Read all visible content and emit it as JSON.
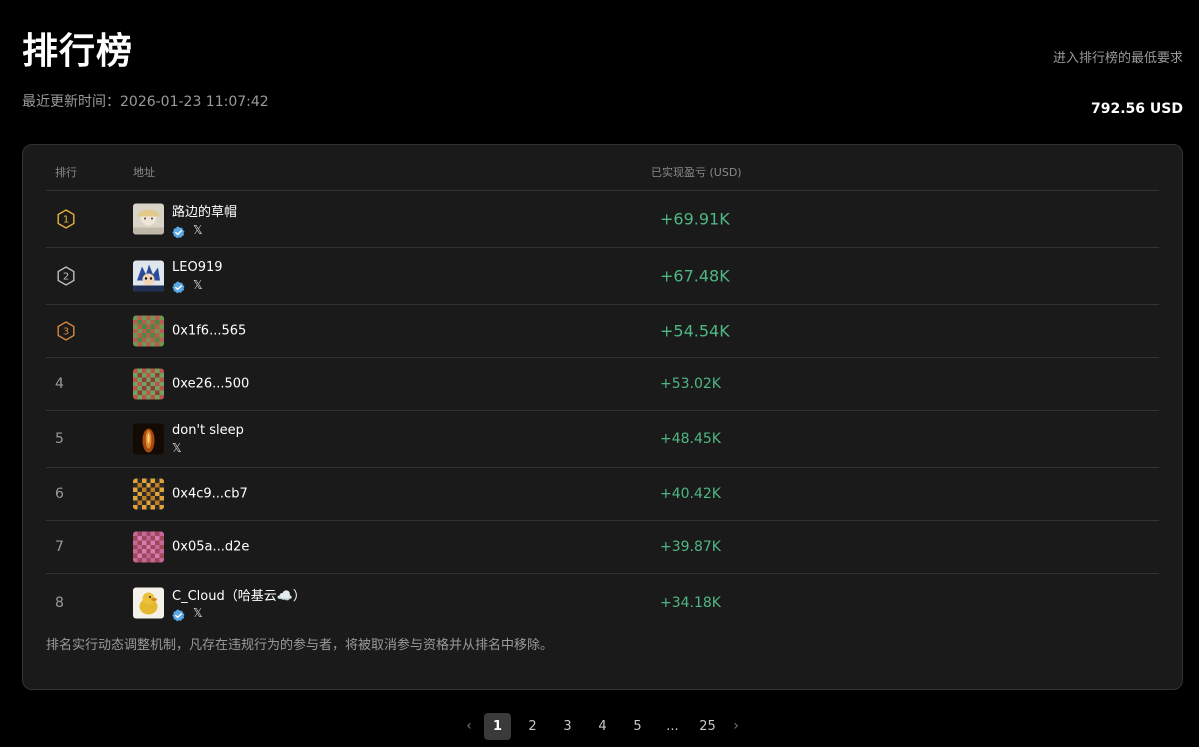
{
  "header": {
    "title": "排行榜",
    "updated": "最近更新时间：2026-01-23 11:07:42",
    "min_label": "进入排行榜的最低要求",
    "min_value": "792.56 USD"
  },
  "table": {
    "col_rank": "排行",
    "col_address": "地址",
    "col_pnl": "已实现盈亏 (USD)"
  },
  "rows": [
    {
      "rank": "1",
      "name": "路边的草帽",
      "verified": true,
      "x": true,
      "pnl": "+69.91K",
      "avatar": "photo-1",
      "medal": "gold"
    },
    {
      "rank": "2",
      "name": "LEO919",
      "verified": true,
      "x": true,
      "pnl": "+67.48K",
      "avatar": "photo-2",
      "medal": "silver"
    },
    {
      "rank": "3",
      "name": "0x1f6...565",
      "verified": false,
      "x": false,
      "pnl": "+54.54K",
      "avatar": "pixel-green",
      "medal": "bronze"
    },
    {
      "rank": "4",
      "name": "0xe26...500",
      "verified": false,
      "x": false,
      "pnl": "+53.02K",
      "avatar": "pixel-red"
    },
    {
      "rank": "5",
      "name": "don't sleep",
      "verified": false,
      "x": true,
      "pnl": "+48.45K",
      "avatar": "photo-dark"
    },
    {
      "rank": "6",
      "name": "0x4c9...cb7",
      "verified": false,
      "x": false,
      "pnl": "+40.42K",
      "avatar": "pixel-yellow"
    },
    {
      "rank": "7",
      "name": "0x05a...d2e",
      "verified": false,
      "x": false,
      "pnl": "+39.87K",
      "avatar": "pixel-pink"
    },
    {
      "rank": "8",
      "name": "C_Cloud（哈基云☁️）",
      "verified": true,
      "x": true,
      "pnl": "+34.18K",
      "avatar": "photo-duck"
    }
  ],
  "notice": "排名实行动态调整机制，凡存在违规行为的参与者，将被取消参与资格并从排名中移除。",
  "pagination": {
    "prev": "‹",
    "pages": [
      "1",
      "2",
      "3",
      "4",
      "5",
      "...",
      "25"
    ],
    "current": "1",
    "next": "›"
  },
  "colors": {
    "background": "#000000",
    "panel": "#1a1a1a",
    "profit": "#4fb783",
    "gold": "#e8b339",
    "silver": "#bfbfbf",
    "bronze": "#d58a3c",
    "verified": "#5aa9e6"
  },
  "icons": {
    "verified": "verified-badge-icon",
    "x": "x-logo-icon",
    "medal": "rank-medal-icon"
  }
}
